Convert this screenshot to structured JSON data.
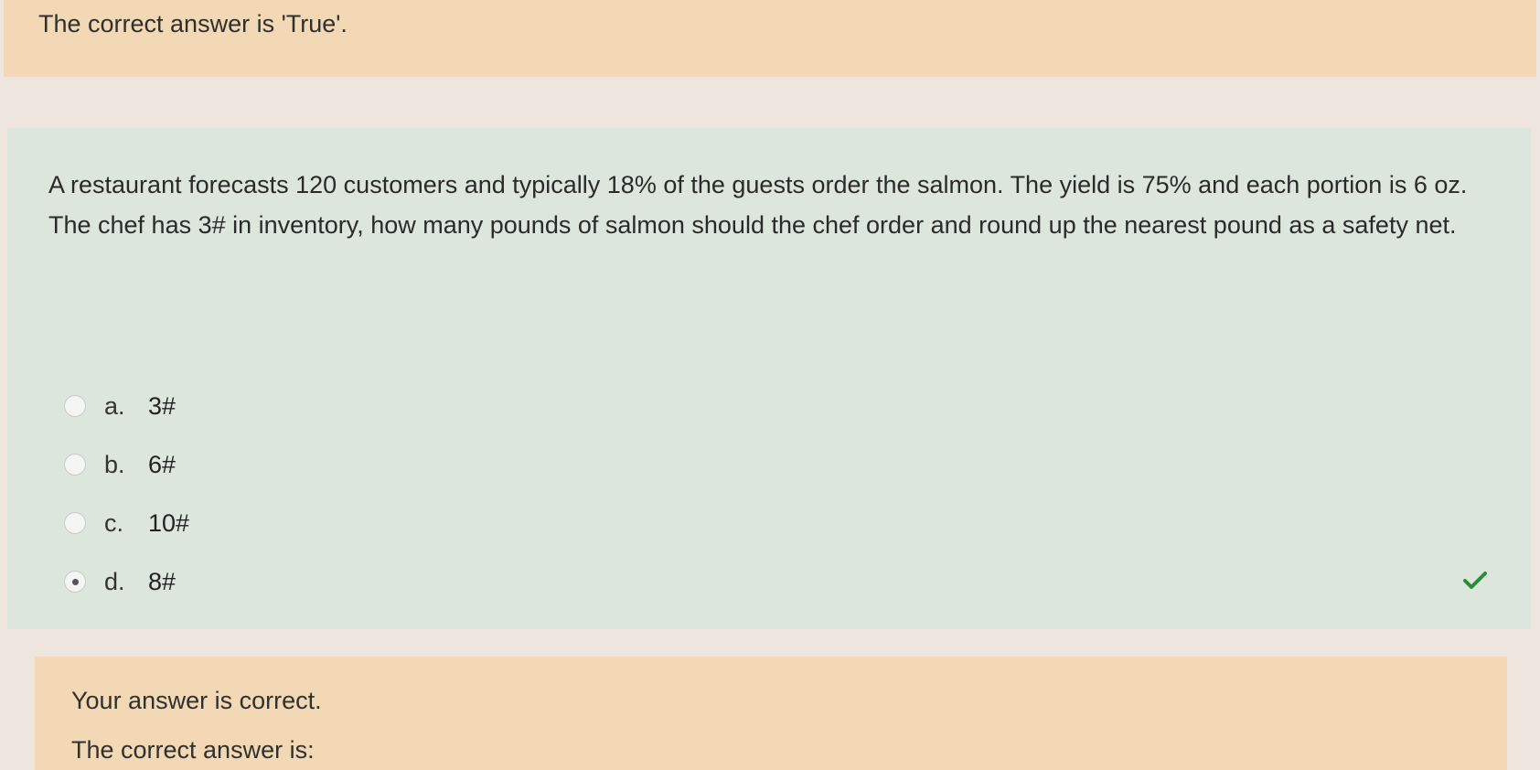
{
  "top_feedback": {
    "text": "The correct answer is 'True'."
  },
  "question": {
    "text": "A restaurant forecasts 120 customers and typically 18% of the guests order the salmon.  The yield is 75% and each portion is 6 oz.  The chef has 3# in inventory, how many pounds of salmon should the chef order and round up the nearest pound as a safety net.",
    "options": [
      {
        "letter": "a.",
        "text": "3#",
        "selected": false,
        "correct": false
      },
      {
        "letter": "b.",
        "text": "6#",
        "selected": false,
        "correct": false
      },
      {
        "letter": "c.",
        "text": "10#",
        "selected": false,
        "correct": false
      },
      {
        "letter": "d.",
        "text": "8#",
        "selected": true,
        "correct": true
      }
    ]
  },
  "bottom_feedback": {
    "status": "Your answer is correct.",
    "answer_label": "The correct answer is:"
  },
  "icons": {
    "correct": "check-icon",
    "option": "radio-button-icon"
  },
  "colors": {
    "feedback_bg": "#f2d8b4",
    "question_bg": "#dde6dc",
    "check": "#2f8b3a"
  }
}
